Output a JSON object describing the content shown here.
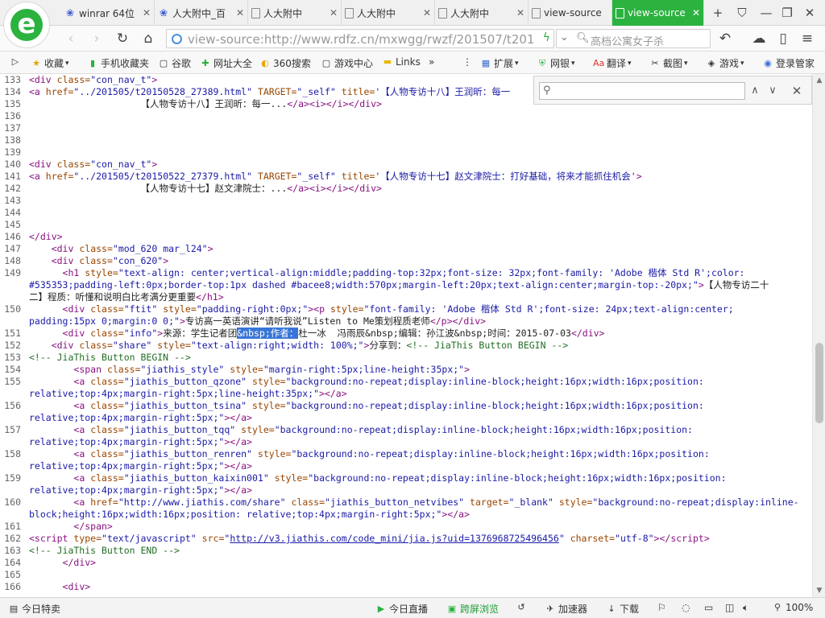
{
  "tabs": [
    {
      "title": "winrar 64位",
      "icon": "paw-icon",
      "active": false
    },
    {
      "title": "人大附中_百",
      "icon": "paw-icon",
      "active": false
    },
    {
      "title": "人大附中",
      "icon": "doc-icon",
      "active": false
    },
    {
      "title": "人大附中",
      "icon": "doc-icon",
      "active": false
    },
    {
      "title": "人大附中",
      "icon": "doc-icon",
      "active": false
    },
    {
      "title": "view-source",
      "icon": "doc-icon",
      "active": false
    },
    {
      "title": "view-source",
      "icon": "doc-icon",
      "active": true
    }
  ],
  "address": {
    "url": "view-source:http://www.rdfz.cn/mxwgg/rwzf/201507/t201"
  },
  "search": {
    "text": "高档公寓女子杀"
  },
  "favorites": [
    "收藏",
    "手机收藏夹",
    "谷歌",
    "网址大全",
    "360搜索",
    "游戏中心",
    "Links",
    "扩展",
    "网银",
    "翻译",
    "截图",
    "游戏",
    "登录管家"
  ],
  "findbar": {
    "value": ""
  },
  "lines": [
    {
      "n": "133",
      "html": "<span class='t'>&lt;div</span> <span class='a'>class=</span><span class='v'>\"con_nav_t\"</span><span class='t'>&gt;</span>"
    },
    {
      "n": "134",
      "html": "<span class='t'>&lt;a</span> <span class='a'>href=</span><span class='v'>\"../201505/t20150528_27389.html\"</span> <span class='a'>TARGET=</span><span class='v'>\"_self\"</span> <span class='a'>title=</span><span class='v'>'【人物专访十八】王润昕：每一</span>"
    },
    {
      "n": "135",
      "html": "                    【人物专访十八】王润昕：每一...<span class='t'>&lt;/a&gt;&lt;i&gt;&lt;/i&gt;&lt;/div&gt;</span>"
    },
    {
      "n": "136",
      "html": ""
    },
    {
      "n": "137",
      "html": ""
    },
    {
      "n": "138",
      "html": ""
    },
    {
      "n": "139",
      "html": ""
    },
    {
      "n": "140",
      "html": "<span class='t'>&lt;div</span> <span class='a'>class=</span><span class='v'>\"con_nav_t\"</span><span class='t'>&gt;</span>"
    },
    {
      "n": "141",
      "html": "<span class='t'>&lt;a</span> <span class='a'>href=</span><span class='v'>\"../201505/t20150522_27379.html\"</span> <span class='a'>TARGET=</span><span class='v'>\"_self\"</span> <span class='a'>title=</span><span class='v'>'【人物专访十七】赵文津院士：打好基础，将来才能抓住机会'</span><span class='t'>&gt;</span>"
    },
    {
      "n": "142",
      "html": "                    【人物专访十七】赵文津院士：...<span class='t'>&lt;/a&gt;&lt;i&gt;&lt;/i&gt;&lt;/div&gt;</span>"
    },
    {
      "n": "143",
      "html": ""
    },
    {
      "n": "144",
      "html": ""
    },
    {
      "n": "145",
      "html": ""
    },
    {
      "n": "146",
      "html": "<span class='t'>&lt;/div&gt;</span>"
    },
    {
      "n": "147",
      "html": "    <span class='t'>&lt;div</span> <span class='a'>class=</span><span class='v'>\"mod_620 mar_l24\"</span><span class='t'>&gt;</span>"
    },
    {
      "n": "148",
      "html": "    <span class='t'>&lt;div</span> <span class='a'>class=</span><span class='v'>\"con_620\"</span><span class='t'>&gt;</span>"
    },
    {
      "n": "149",
      "html": "      <span class='t'>&lt;h1</span> <span class='a'>style=</span><span class='v'>\"text-align: center;vertical-align:middle;padding-top:32px;font-size: 32px;font-family: 'Adobe 楷体 Std R';color:</span>"
    },
    {
      "n": "",
      "html": "<span class='v'>#535353;padding-left:0px;border-top:1px dashed #bacee8;width:570px;margin-left:20px;text-align:center;margin-top:-20px;\"</span><span class='t'>&gt;</span>【人物专访二十"
    },
    {
      "n": "",
      "html": "二】程质：听懂和说明白比考满分更重要<span class='t'>&lt;/h1&gt;</span>"
    },
    {
      "n": "150",
      "html": "      <span class='t'>&lt;div</span> <span class='a'>class=</span><span class='v'>\"ftit\"</span> <span class='a'>style=</span><span class='v'>\"padding-right:0px;\"</span><span class='t'>&gt;&lt;p</span> <span class='a'>style=</span><span class='v'>\"font-family: 'Adobe 楷体 Std R';font-size: 24px;text-align:center;</span>"
    },
    {
      "n": "",
      "html": "<span class='v'>padding:15px 0;margin:0 0;\"</span><span class='t'>&gt;</span>专访高一英语演讲“请听我说”Listen to Me策划程质老师<span class='t'>&lt;/p&gt;&lt;/div&gt;</span>"
    },
    {
      "n": "151",
      "html": "      <span class='t'>&lt;div</span> <span class='a'>class=</span><span class='v'>\"info\"</span><span class='t'>&gt;</span>来源：学生记者团<span class='hl'>&amp;nbsp;作者：</span>杜一冰  冯雨辰&amp;nbsp;编辑：孙江波&amp;nbsp;时间：2015-07-03<span class='t'>&lt;/div&gt;</span>"
    },
    {
      "n": "152",
      "html": "    <span class='t'>&lt;div</span> <span class='a'>class=</span><span class='v'>\"share\"</span> <span class='a'>style=</span><span class='v'>\"text-align:right;width: 100%;\"</span><span class='t'>&gt;</span>分享到：<span class='cm'>&lt;!-- JiaThis Button BEGIN --&gt;</span>"
    },
    {
      "n": "153",
      "html": "<span class='cm'>&lt;!-- JiaThis Button BEGIN --&gt;</span>"
    },
    {
      "n": "154",
      "html": "        <span class='t'>&lt;span</span> <span class='a'>class=</span><span class='v'>\"jiathis_style\"</span> <span class='a'>style=</span><span class='v'>\"margin-right:5px;line-height:35px;\"</span><span class='t'>&gt;</span>"
    },
    {
      "n": "155",
      "html": "        <span class='t'>&lt;a</span> <span class='a'>class=</span><span class='v'>\"jiathis_button_qzone\"</span> <span class='a'>style=</span><span class='v'>\"background:no-repeat;display:inline-block;height:16px;width:16px;position:</span>"
    },
    {
      "n": "",
      "html": "<span class='v'>relative;top:4px;margin-right:5px;line-height:35px;\"</span><span class='t'>&gt;&lt;/a&gt;</span>"
    },
    {
      "n": "156",
      "html": "        <span class='t'>&lt;a</span> <span class='a'>class=</span><span class='v'>\"jiathis_button_tsina\"</span> <span class='a'>style=</span><span class='v'>\"background:no-repeat;display:inline-block;height:16px;width:16px;position:</span>"
    },
    {
      "n": "",
      "html": "<span class='v'>relative;top:4px;margin-right:5px;\"</span><span class='t'>&gt;&lt;/a&gt;</span>"
    },
    {
      "n": "157",
      "html": "        <span class='t'>&lt;a</span> <span class='a'>class=</span><span class='v'>\"jiathis_button_tqq\"</span> <span class='a'>style=</span><span class='v'>\"background:no-repeat;display:inline-block;height:16px;width:16px;position:</span>"
    },
    {
      "n": "",
      "html": "<span class='v'>relative;top:4px;margin-right:5px;\"</span><span class='t'>&gt;&lt;/a&gt;</span>"
    },
    {
      "n": "158",
      "html": "        <span class='t'>&lt;a</span> <span class='a'>class=</span><span class='v'>\"jiathis_button_renren\"</span> <span class='a'>style=</span><span class='v'>\"background:no-repeat;display:inline-block;height:16px;width:16px;position:</span>"
    },
    {
      "n": "",
      "html": "<span class='v'>relative;top:4px;margin-right:5px;\"</span><span class='t'>&gt;&lt;/a&gt;</span>"
    },
    {
      "n": "159",
      "html": "        <span class='t'>&lt;a</span> <span class='a'>class=</span><span class='v'>\"jiathis_button_kaixin001\"</span> <span class='a'>style=</span><span class='v'>\"background:no-repeat;display:inline-block;height:16px;width:16px;position:</span>"
    },
    {
      "n": "",
      "html": "<span class='v'>relative;top:4px;margin-right:5px;\"</span><span class='t'>&gt;&lt;/a&gt;</span>"
    },
    {
      "n": "160",
      "html": "        <span class='t'>&lt;a</span> <span class='a'>href=</span><span class='v'>\"http://www.jiathis.com/share\"</span> <span class='a'>class=</span><span class='v'>\"jiathis_button_netvibes\"</span> <span class='a'>target=</span><span class='v'>\"_blank\"</span> <span class='a'>style=</span><span class='v'>\"background:no-repeat;display:inline-</span>"
    },
    {
      "n": "",
      "html": "<span class='v'>block;height:16px;width:16px;position: relative;top:4px;margin-right:5px;\"</span><span class='t'>&gt;&lt;/a&gt;</span>"
    },
    {
      "n": "161",
      "html": "        <span class='t'>&lt;/span&gt;</span>"
    },
    {
      "n": "162",
      "html": "<span class='t'>&lt;script</span> <span class='a'>type=</span><span class='v'>\"text/javascript\"</span> <span class='a'>src=</span><span class='v'>\"</span><span class='lk'>http://v3.jiathis.com/code_mini/jia.js?uid=1376968725496456</span><span class='v'>\"</span> <span class='a'>charset=</span><span class='v'>\"utf-8\"</span><span class='t'>&gt;&lt;/script&gt;</span>"
    },
    {
      "n": "163",
      "html": "<span class='cm'>&lt;!-- JiaThis Button END --&gt;</span>"
    },
    {
      "n": "164",
      "html": "      <span class='t'>&lt;/div&gt;</span>"
    },
    {
      "n": "165",
      "html": ""
    },
    {
      "n": "166",
      "html": "      <span class='t'>&lt;div&gt;</span>"
    }
  ],
  "status": {
    "left": "今日特卖",
    "live": "今日直播",
    "cross": "跨屏浏览",
    "speed": "加速器",
    "download": "下载",
    "zoom": "100%"
  }
}
